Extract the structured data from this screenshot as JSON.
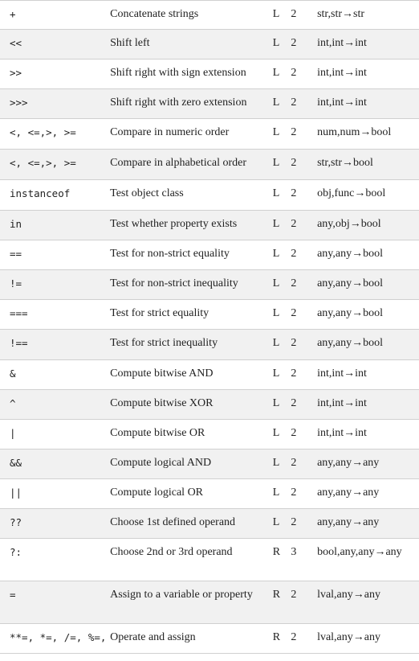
{
  "rows": [
    {
      "op": "+",
      "desc": "Concatenate strings",
      "assoc": "L",
      "num": "2",
      "types": "str,str→str"
    },
    {
      "op": "<<",
      "desc": "Shift left",
      "assoc": "L",
      "num": "2",
      "types": "int,int→int"
    },
    {
      "op": ">>",
      "desc": "Shift right with sign extension",
      "assoc": "L",
      "num": "2",
      "types": "int,int→int"
    },
    {
      "op": ">>>",
      "desc": "Shift right with zero extension",
      "assoc": "L",
      "num": "2",
      "types": "int,int→int"
    },
    {
      "op": "<, <=,>, >=",
      "desc": "Compare in numeric order",
      "assoc": "L",
      "num": "2",
      "types": "num,num→bool"
    },
    {
      "op": "<, <=,>, >=",
      "desc": "Compare in alphabetical order",
      "assoc": "L",
      "num": "2",
      "types": "str,str→bool"
    },
    {
      "op": "instanceof",
      "desc": "Test object class",
      "assoc": "L",
      "num": "2",
      "types": "obj,func→bool"
    },
    {
      "op": "in",
      "desc": "Test whether property exists",
      "assoc": "L",
      "num": "2",
      "types": "any,obj→bool"
    },
    {
      "op": "==",
      "desc": "Test for non-strict equality",
      "assoc": "L",
      "num": "2",
      "types": "any,any→bool"
    },
    {
      "op": "!=",
      "desc": "Test for non-strict inequality",
      "assoc": "L",
      "num": "2",
      "types": "any,any→bool"
    },
    {
      "op": "===",
      "desc": "Test for strict equality",
      "assoc": "L",
      "num": "2",
      "types": "any,any→bool"
    },
    {
      "op": "!==",
      "desc": "Test for strict inequality",
      "assoc": "L",
      "num": "2",
      "types": "any,any→bool"
    },
    {
      "op": "&",
      "desc": "Compute bitwise AND",
      "assoc": "L",
      "num": "2",
      "types": "int,int→int"
    },
    {
      "op": "^",
      "desc": "Compute bitwise XOR",
      "assoc": "L",
      "num": "2",
      "types": "int,int→int"
    },
    {
      "op": "|",
      "desc": "Compute bitwise OR",
      "assoc": "L",
      "num": "2",
      "types": "int,int→int"
    },
    {
      "op": "&&",
      "desc": "Compute logical AND",
      "assoc": "L",
      "num": "2",
      "types": "any,any→any"
    },
    {
      "op": "||",
      "desc": "Compute logical OR",
      "assoc": "L",
      "num": "2",
      "types": "any,any→any"
    },
    {
      "op": "??",
      "desc": "Choose 1st defined operand",
      "assoc": "L",
      "num": "2",
      "types": "any,any→any"
    },
    {
      "op": "?:",
      "desc": "Choose 2nd or 3rd operand",
      "assoc": "R",
      "num": "3",
      "types": "bool,any,any→any"
    },
    {
      "op": "=",
      "desc": "Assign to a variable or property",
      "assoc": "R",
      "num": "2",
      "types": "lval,any→any"
    },
    {
      "op": "**=, *=, /=, %=,",
      "desc": "Operate and assign",
      "assoc": "R",
      "num": "2",
      "types": "lval,any→any"
    }
  ]
}
